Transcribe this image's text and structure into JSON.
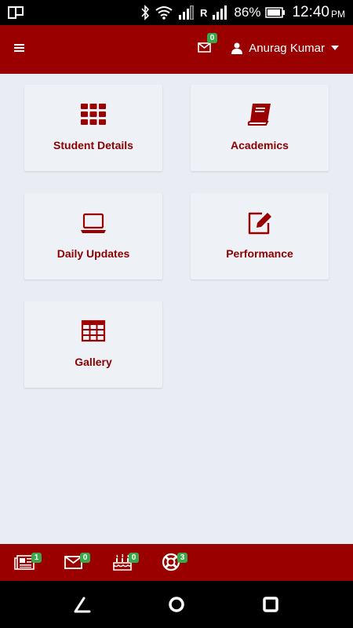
{
  "status_bar": {
    "battery_percent": "86%",
    "time": "12:40",
    "ampm": "PM",
    "roaming_label": "R"
  },
  "header": {
    "messages_badge": "0",
    "user_name": "Anurag Kumar"
  },
  "tiles": [
    {
      "label": "Student Details",
      "icon": "grid-apps-icon"
    },
    {
      "label": "Academics",
      "icon": "book-icon"
    },
    {
      "label": "Daily Updates",
      "icon": "laptop-icon"
    },
    {
      "label": "Performance",
      "icon": "edit-icon"
    },
    {
      "label": "Gallery",
      "icon": "table-icon"
    }
  ],
  "bottom_bar": [
    {
      "icon": "newspaper-icon",
      "badge": "1"
    },
    {
      "icon": "envelope-icon",
      "badge": "0"
    },
    {
      "icon": "birthday-cake-icon",
      "badge": "0"
    },
    {
      "icon": "lifebuoy-icon",
      "badge": "3"
    }
  ],
  "colors": {
    "brand": "#9b0000",
    "label": "#8b0000",
    "badge": "#3aa84a",
    "background": "#e9edf3"
  }
}
